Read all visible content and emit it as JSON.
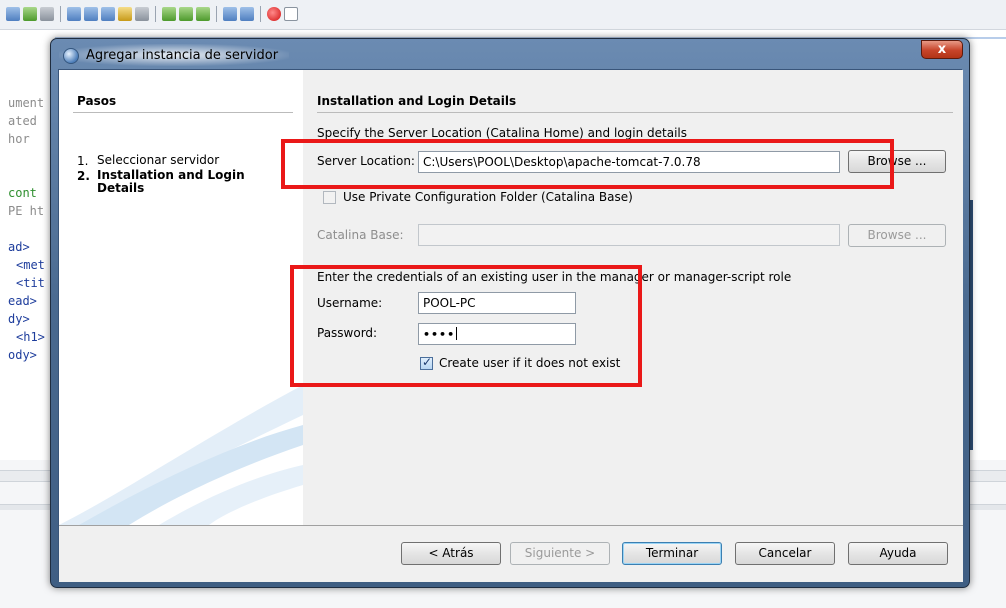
{
  "ide": {
    "code_lines": [
      "ument",
      "ated",
      "hor",
      "cont",
      "PE ht",
      "ad>",
      "<met",
      "<tit",
      "ead>",
      "dy>",
      "<h1>",
      "ody>"
    ]
  },
  "dialog": {
    "title": "Agregar instancia de servidor",
    "close_label": "x",
    "steps": {
      "title": "Pasos",
      "items": [
        {
          "num": "1.",
          "label": "Seleccionar servidor"
        },
        {
          "num": "2.",
          "label": "Installation and Login Details"
        }
      ]
    },
    "section": {
      "title": "Installation and Login Details",
      "description": "Specify the Server Location (Catalina Home) and login details",
      "server_location_label": "Server Location:",
      "server_location_value": "C:\\Users\\POOL\\Desktop\\apache-tomcat-7.0.78",
      "browse_label": "Browse ...",
      "private_config_label": "Use Private Configuration Folder (Catalina Base)",
      "catalina_base_label": "Catalina Base:",
      "catalina_base_value": "",
      "credentials_text": "Enter the credentials of an existing user in the manager or manager-script role",
      "username_label": "Username:",
      "username_value": "POOL-PC",
      "password_label": "Password:",
      "password_value": "••••",
      "create_user_label": "Create user if it does not exist",
      "create_user_checked": true
    },
    "footer": {
      "back_label": "< Atrás",
      "next_label": "Siguiente >",
      "finish_label": "Terminar",
      "cancel_label": "Cancelar",
      "help_label": "Ayuda"
    }
  },
  "colors": {
    "annotation": "#ea1818",
    "frame": "#49698f",
    "panel": "#f0f0f0"
  }
}
